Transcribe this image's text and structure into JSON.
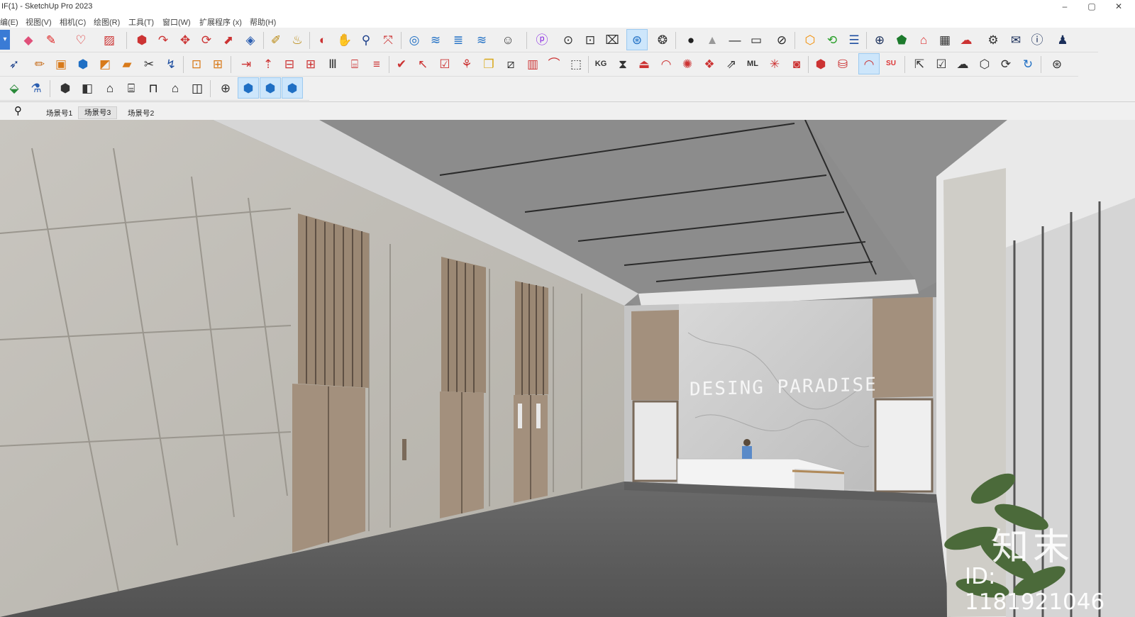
{
  "window": {
    "title": "IF(1) - SketchUp Pro 2023",
    "controls": {
      "minimize": "–",
      "maximize": "▢",
      "close": "✕"
    }
  },
  "menu": {
    "items": [
      "编(E)",
      "视图(V)",
      "相机(C)",
      "绘图(R)",
      "工具(T)",
      "窗口(W)",
      "扩展程序 (x)",
      "帮助(H)"
    ]
  },
  "toolbar1": {
    "icons": [
      "dropdown-icon",
      "eraser-icon",
      "pencil-line-icon",
      "freehand-icon",
      "rectangle-icon",
      "push-pull-icon",
      "follow-me-icon",
      "move-icon",
      "rotate-icon",
      "scale-icon",
      "offset-icon",
      "tape-measure-icon",
      "paint-bucket-icon",
      "orbit-icon",
      "pan-icon",
      "zoom-icon",
      "zoom-extents-icon",
      "layers-icon",
      "stack-icon",
      "stack-alt-icon",
      "sandbox-icon",
      "user-icon",
      "plugin-p-icon",
      "camera-orbit-icon",
      "camera-icon",
      "camera-screenshot-icon",
      "cursor-help-icon",
      "gear-cluster-icon",
      "dot-icon",
      "triangle-icon",
      "dash-icon",
      "square-icon",
      "hide-icon",
      "layout-icon",
      "refresh-icon",
      "stack-orange-icon",
      "add-circle-icon",
      "tree-icon",
      "warehouse-icon",
      "checker-icon",
      "cloud-upload-icon",
      "settings-icon",
      "mail-icon",
      "info-icon",
      "account-icon"
    ]
  },
  "toolbar2": {
    "icons": [
      "select-icon",
      "pencil-icon",
      "component-icon",
      "group-icon",
      "texture-icon",
      "eraser-orange-icon",
      "scissors-icon",
      "path-icon",
      "box-icon",
      "box-alt-icon",
      "arrow-right-icon",
      "arrow-up-icon",
      "frame-icon",
      "grid-icon",
      "column-icon",
      "stairs-icon",
      "ribbon-icon",
      "check-icon",
      "cursor-path-icon",
      "check-alt-icon",
      "tree-branch-icon",
      "layers-square-icon",
      "crop-icon",
      "chart-bars-icon",
      "curve-icon",
      "select-rect-icon",
      "kg-icon",
      "mirror-icon",
      "extrude-icon",
      "arc-icon",
      "gear-red-icon",
      "cubes-icon",
      "export-icon",
      "ml-icon",
      "axis-icon",
      "camera-red-icon",
      "material-icon",
      "bucket-red-icon",
      "brush-icon",
      "su-app-icon",
      "folder-export-icon",
      "checkbox-icon",
      "cloud-icon",
      "cube-outline-icon",
      "cube-refresh-icon",
      "refresh-blue-icon",
      "aperture-icon"
    ]
  },
  "toolbar3": {
    "icons": [
      "component-green-icon",
      "eyedropper-icon",
      "iso-view-icon",
      "front-view-icon",
      "home-icon",
      "back-view-icon",
      "side-view-icon",
      "house-outline-icon",
      "square-view-icon",
      "target-icon",
      "cube-blue-icon",
      "cube-blue-alt-icon",
      "cube-blue-x-icon"
    ]
  },
  "scenes": {
    "search_icon": "magnifier-icon",
    "tabs": [
      "场景号1",
      "场景号3",
      "场景号2"
    ]
  },
  "viewport": {
    "sign_text": "DESING PARADISE",
    "watermark_brand": "知末",
    "watermark_id": "ID: 1181921046"
  }
}
